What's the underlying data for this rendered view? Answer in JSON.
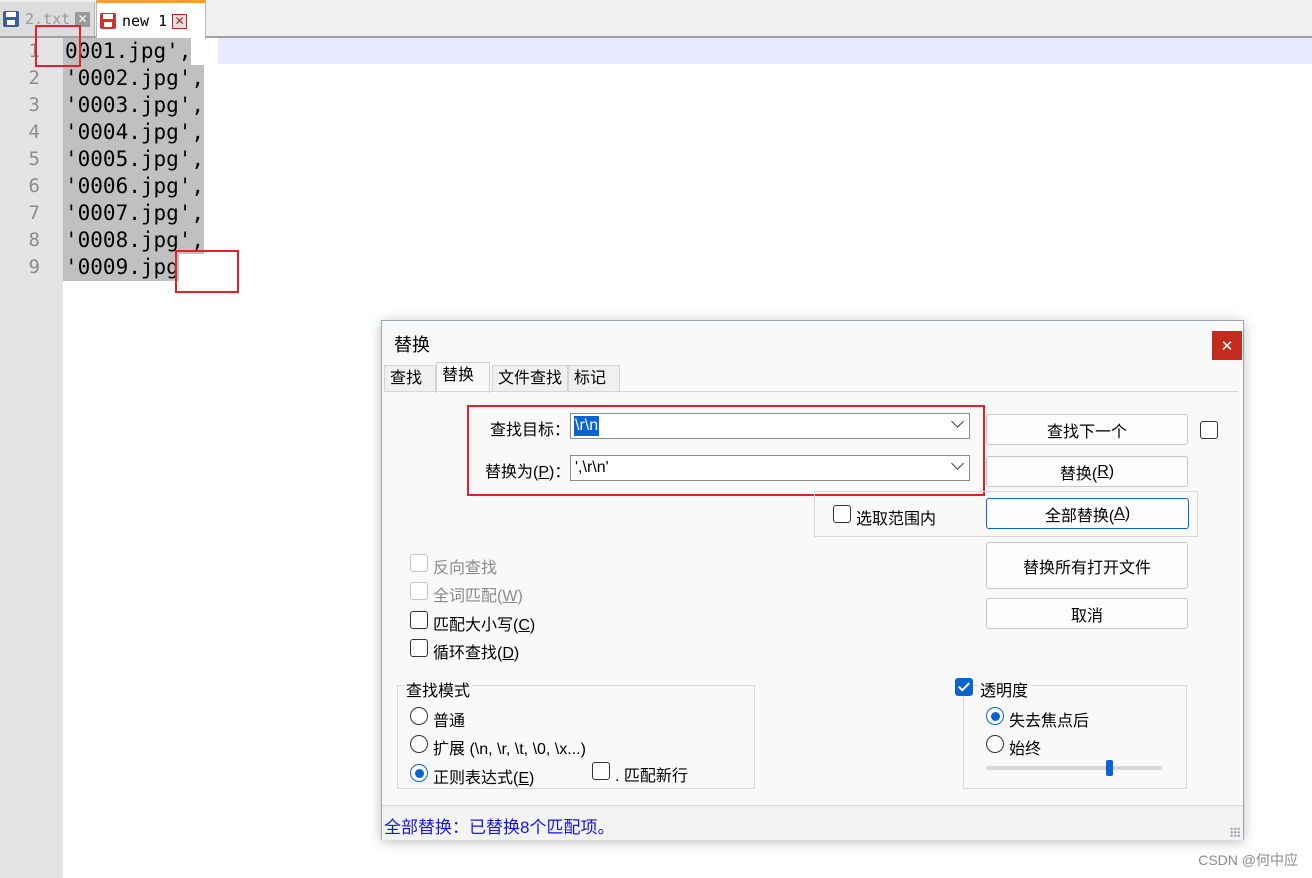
{
  "tabs": [
    {
      "label": "2.txt",
      "close": "✕"
    },
    {
      "label": "new 1",
      "close": "✕"
    }
  ],
  "editor": {
    "line_numbers": [
      "1",
      "2",
      "3",
      "4",
      "5",
      "6",
      "7",
      "8",
      "9"
    ],
    "lines": [
      "0001.jpg',",
      "'0002.jpg',",
      "'0003.jpg',",
      "'0004.jpg',",
      "'0005.jpg',",
      "'0006.jpg',",
      "'0007.jpg',",
      "'0008.jpg',",
      "'0009.jpg"
    ]
  },
  "dialog": {
    "title": "替换",
    "close": "✕",
    "tabs": [
      "查找",
      "替换",
      "文件查找",
      "标记"
    ],
    "find_label": "查找目标：",
    "find_value": "\\r\\n",
    "replace_label_pre": "替换为(",
    "replace_label_key": "P",
    "replace_label_post": ")：",
    "replace_value": "',\\r\\n'",
    "buttons": {
      "find_next": "查找下一个",
      "replace_pre": "替换(",
      "replace_key": "R",
      "replace_post": ")",
      "replace_all_pre": "全部替换(",
      "replace_all_key": "A",
      "replace_all_post": ")",
      "replace_all_open": "替换所有打开文件",
      "cancel": "取消"
    },
    "in_selection": "选取范围内",
    "options": {
      "backward": "反向查找",
      "whole_word_pre": "全词匹配(",
      "whole_word_key": "W",
      "whole_word_post": ")",
      "match_case_pre": "匹配大小写(",
      "match_case_key": "C",
      "match_case_post": ")",
      "wrap_pre": "循环查找(",
      "wrap_key": "D",
      "wrap_post": ")"
    },
    "search_mode": {
      "title": "查找模式",
      "normal": "普通",
      "extended": "扩展 (\\n, \\r, \\t, \\0, \\x...)",
      "regex_pre": "正则表达式(",
      "regex_key": "E",
      "regex_post": ")",
      "dot_newline": ". 匹配新行",
      "selected": "regex"
    },
    "transparency": {
      "label": "透明度",
      "checked": true,
      "on_lose_focus": "失去焦点后",
      "always": "始终",
      "selected": "on_lose_focus",
      "level": 0.7
    },
    "status": "全部替换：已替换8个匹配项。"
  },
  "watermark": "CSDN @何中应",
  "colors": {
    "selection_gray": "#c0c0c0",
    "current_line": "#e8e8ff",
    "accent_blue": "#0a64d0",
    "annotation_red": "#e0202a",
    "status_blue": "#1414e0",
    "close_red": "#c42b1c"
  }
}
